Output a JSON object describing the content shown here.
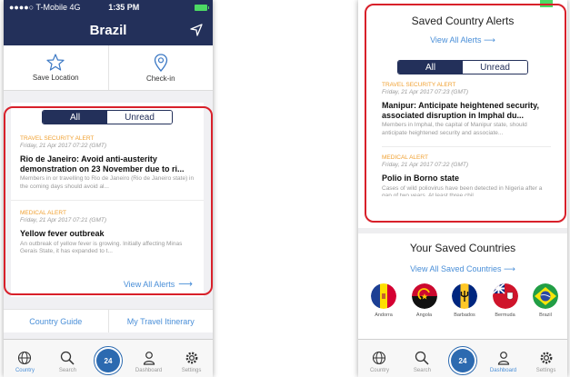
{
  "left": {
    "status": {
      "carrier": "●●●●○ T-Mobile  4G",
      "time": "1:35 PM"
    },
    "header": {
      "title": "Brazil"
    },
    "actions": {
      "save_location": "Save Location",
      "check_in": "Check-in"
    },
    "segment": {
      "all": "All",
      "unread": "Unread"
    },
    "alerts": [
      {
        "category": "TRAVEL SECURITY ALERT",
        "date": "Friday, 21 Apr 2017 07:22 (GMT)",
        "headline": "Rio de Janeiro: Avoid anti-austerity demonstration on 23 November due to ri...",
        "body": "Members in or travelling to Rio de Janeiro (Rio de Janeiro state) in the coming days should avoid al..."
      },
      {
        "category": "MEDICAL ALERT",
        "date": "Friday, 21 Apr 2017 07:21 (GMT)",
        "headline": "Yellow fever outbreak",
        "body": "An outbreak of yellow fever is growing. Initially affecting Minas Gerais State, it has expanded to t..."
      }
    ],
    "view_all": "View All Alerts",
    "bottom_links": {
      "country_guide": "Country Guide",
      "itinerary": "My Travel Itinerary"
    },
    "tabs": [
      {
        "label": "Country",
        "icon": "globe-icon"
      },
      {
        "label": "Search",
        "icon": "search-icon"
      },
      {
        "label": "Dashboard",
        "icon": "user-icon"
      },
      {
        "label": "Settings",
        "icon": "gear-icon"
      }
    ],
    "fab_label": "24"
  },
  "right": {
    "title": "Saved Country Alerts",
    "view_all": "View All Alerts",
    "segment": {
      "all": "All",
      "unread": "Unread"
    },
    "alerts": [
      {
        "category": "TRAVEL SECURITY ALERT",
        "date": "Friday, 21 Apr 2017 07:23 (GMT)",
        "headline": "Manipur: Anticipate heightened security, associated disruption in Imphal du...",
        "body": "Members in Imphal, the capital of Manipur state, should anticipate heightened security and associate..."
      },
      {
        "category": "MEDICAL ALERT",
        "date": "Friday, 21 Apr 2017 07:22 (GMT)",
        "headline": "Polio in Borno state",
        "body": "Cases of wild poliovirus have been detected in Nigeria after a gap of two years. At least three chil"
      }
    ],
    "saved_title": "Your Saved Countries",
    "saved_link": "View All Saved Countries",
    "countries": [
      "Andorra",
      "Angola",
      "Barbados",
      "Bermuda",
      "Brazil"
    ],
    "tabs": [
      {
        "label": "Country",
        "icon": "globe-icon"
      },
      {
        "label": "Search",
        "icon": "search-icon"
      },
      {
        "label": "Dashboard",
        "icon": "user-icon"
      },
      {
        "label": "Settings",
        "icon": "gear-icon"
      }
    ],
    "fab_label": "24"
  },
  "colors": {
    "navy": "#23305a",
    "link": "#4a8fd8",
    "alert_orange": "#f0a030",
    "highlight_red": "#d8202a"
  }
}
